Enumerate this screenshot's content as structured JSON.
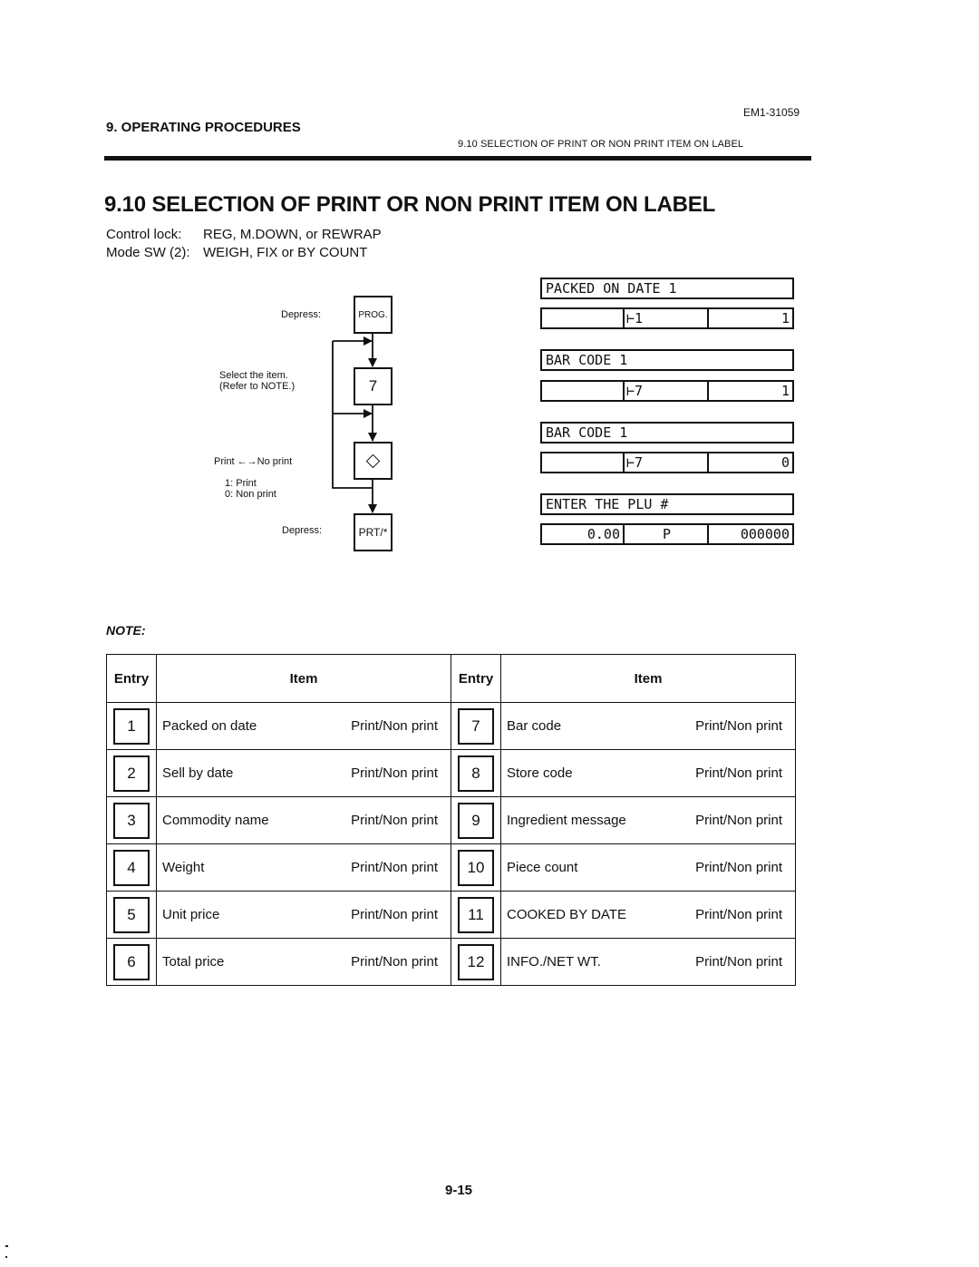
{
  "header": {
    "doc_id": "EM1-31059",
    "chapter": "9. OPERATING PROCEDURES",
    "section_ref": "9.10  SELECTION OF PRINT OR NON PRINT ITEM ON LABEL"
  },
  "title": "9.10 SELECTION OF PRINT OR NON PRINT ITEM ON LABEL",
  "meta": [
    {
      "label": "Control lock:",
      "value": "REG, M.DOWN, or REWRAP"
    },
    {
      "label": "Mode SW (2):",
      "value": "WEIGH, FIX or BY COUNT"
    }
  ],
  "flowchart": {
    "depress_label_1": "Depress:",
    "key_prog": "PROG.",
    "select_label_1": "Select the item.",
    "select_label_2": "(Refer to NOTE.)",
    "key_item": "7",
    "print_toggle_label": "Print ←→No print",
    "option_1": "1: Print",
    "option_0": "0: Non print",
    "key_toggle_icon": "diamond-icon",
    "depress_label_2": "Depress:",
    "key_prt": "PRT/*"
  },
  "displays": [
    {
      "top": "PACKED ON DATE 1",
      "c1": "",
      "c2": "⊢1",
      "c3": "1"
    },
    {
      "top": "BAR CODE 1",
      "c1": "",
      "c2": "⊢7",
      "c3": "1"
    },
    {
      "top": "BAR CODE 1",
      "c1": "",
      "c2": "⊢7",
      "c3": "0"
    },
    {
      "top": "ENTER THE PLU #",
      "c1": "0.00",
      "c2": "P",
      "c3": "000000"
    }
  ],
  "note": {
    "label": "NOTE:",
    "headers": {
      "entry": "Entry",
      "item": "Item"
    },
    "rows": [
      {
        "left": {
          "entry": "1",
          "item": "Packed on date",
          "setting": "Print/Non print"
        },
        "right": {
          "entry": "7",
          "item": "Bar code",
          "setting": "Print/Non print"
        }
      },
      {
        "left": {
          "entry": "2",
          "item": "Sell by date",
          "setting": "Print/Non print"
        },
        "right": {
          "entry": "8",
          "item": "Store code",
          "setting": "Print/Non print"
        }
      },
      {
        "left": {
          "entry": "3",
          "item": "Commodity name",
          "setting": "Print/Non print"
        },
        "right": {
          "entry": "9",
          "item": "Ingredient message",
          "setting": "Print/Non print"
        }
      },
      {
        "left": {
          "entry": "4",
          "item": "Weight",
          "setting": "Print/Non print"
        },
        "right": {
          "entry": "10",
          "item": "Piece count",
          "setting": "Print/Non print"
        }
      },
      {
        "left": {
          "entry": "5",
          "item": "Unit price",
          "setting": "Print/Non print"
        },
        "right": {
          "entry": "11",
          "item": "COOKED BY DATE",
          "setting": "Print/Non print"
        }
      },
      {
        "left": {
          "entry": "6",
          "item": "Total price",
          "setting": "Print/Non print"
        },
        "right": {
          "entry": "12",
          "item": "INFO./NET WT.",
          "setting": "Print/Non print"
        }
      }
    ]
  },
  "footer": {
    "page_number": "9-15"
  }
}
